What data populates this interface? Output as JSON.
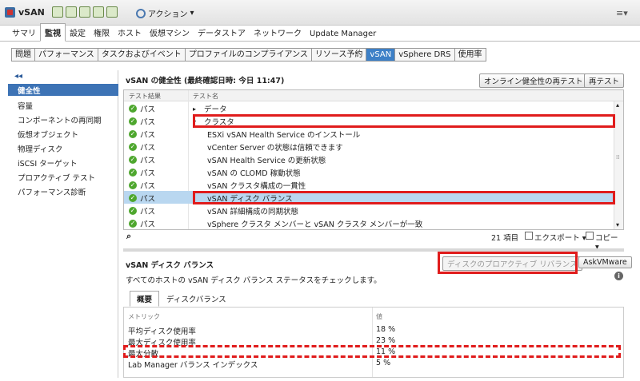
{
  "app": {
    "title": "vSAN",
    "actions_label": "アクション",
    "actions_arrow": "▾",
    "menu_icon": "≡▾"
  },
  "main_tabs": [
    "サマリ",
    "監視",
    "設定",
    "権限",
    "ホスト",
    "仮想マシン",
    "データストア",
    "ネットワーク",
    "Update Manager"
  ],
  "sub_tabs": [
    "問題",
    "パフォーマンス",
    "タスクおよびイベント",
    "プロファイルのコンプライアンス",
    "リソース予約",
    "vSAN",
    "vSphere DRS",
    "使用率"
  ],
  "left_panel": {
    "collapse": "◂◂",
    "items": [
      "健全性",
      "容量",
      "コンポーネントの再同期",
      "仮想オブジェクト",
      "物理ディスク",
      "iSCSI ターゲット",
      "プロアクティブ テスト",
      "パフォーマンス診断"
    ]
  },
  "health": {
    "header": "vSAN の健全性 (最終確認日時: 今日 11:47)",
    "btn_online": "オンライン健全性の再テスト",
    "btn_retest": "再テスト",
    "col_result": "テスト結果",
    "col_name": "テスト名",
    "rows": [
      {
        "result": "パス",
        "arrow": "▸",
        "name": "データ"
      },
      {
        "result": "パス",
        "arrow": "▾",
        "name": "クラスタ"
      },
      {
        "result": "パス",
        "arrow": "",
        "name": "ESXi vSAN Health Service のインストール"
      },
      {
        "result": "パス",
        "arrow": "",
        "name": "vCenter Server の状態は信頼できます"
      },
      {
        "result": "パス",
        "arrow": "",
        "name": "vSAN Health Service の更新状態"
      },
      {
        "result": "パス",
        "arrow": "",
        "name": "vSAN の CLOMD 稼動状態"
      },
      {
        "result": "パス",
        "arrow": "",
        "name": "vSAN クラスタ構成の一貫性"
      },
      {
        "result": "パス",
        "arrow": "",
        "name": "vSAN ディスク バランス"
      },
      {
        "result": "パス",
        "arrow": "",
        "name": "vSAN 詳細構成の同期状態"
      },
      {
        "result": "パス",
        "arrow": "",
        "name": "vSphere クラスタ メンバーと vSAN クラスタ メンバーが一致"
      }
    ],
    "count": "21 項目",
    "export": "エクスポート ▾",
    "copy": "コピー ▾",
    "scroll_up": "▴",
    "scroll_down": "▾",
    "scroll_grip": "⁞⁞",
    "binoculars": "⌕"
  },
  "disk_balance": {
    "title": "vSAN ディスク バランス",
    "btn_rebalance": "ディスクのプロアクティブ リバランス",
    "btn_askvm": "AskVMware",
    "description": "すべてのホストの vSAN ディスク バランス ステータスをチェックします。",
    "info": "i",
    "tabs": [
      "概要",
      "ディスクバランス"
    ],
    "col_metric": "メトリック",
    "col_value": "値",
    "metrics": [
      {
        "name": "平均ディスク使用率",
        "value": "18 %"
      },
      {
        "name": "最大ディスク使用率",
        "value": "23 %"
      },
      {
        "name": "最大分散",
        "value": "11 %"
      },
      {
        "name": "Lab Manager バランス インデックス",
        "value": "5 %"
      }
    ]
  },
  "colors": {
    "accent": "#3d73b5",
    "highlight": "#e01c1c",
    "pass": "#4ea72e",
    "selected_row": "#b9d7f0"
  }
}
